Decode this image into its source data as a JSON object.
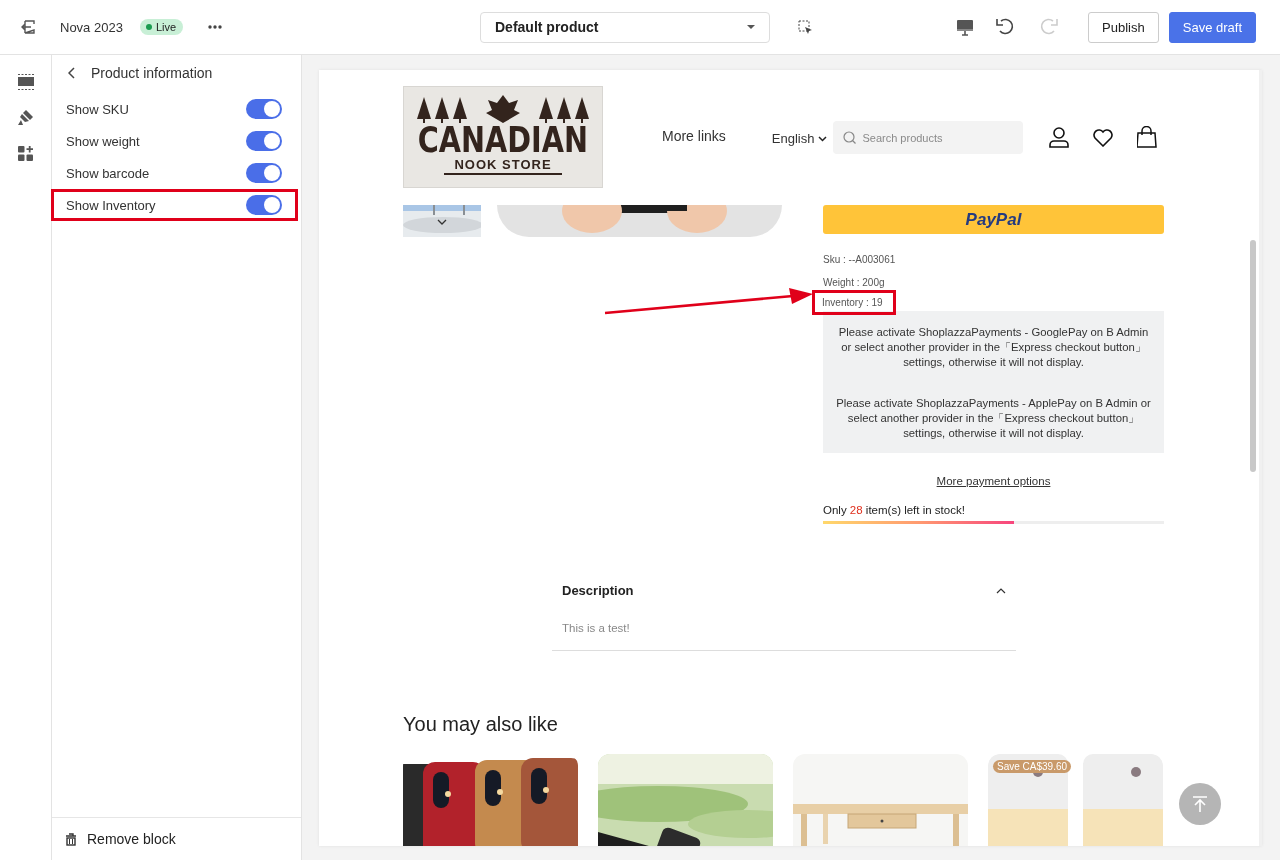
{
  "topbar": {
    "title": "Nova 2023",
    "status": "Live",
    "template": "Default product",
    "redo_disabled": true,
    "buttons": [
      {
        "label": "Publish",
        "kind": "secondary"
      },
      {
        "label": "Save draft",
        "kind": "primary"
      }
    ]
  },
  "panel": {
    "title": "Product information",
    "toggles": [
      {
        "label": "Show SKU",
        "on": true,
        "highlighted": false
      },
      {
        "label": "Show weight",
        "on": true,
        "highlighted": false
      },
      {
        "label": "Show barcode",
        "on": true,
        "highlighted": false
      },
      {
        "label": "Show Inventory",
        "on": true,
        "highlighted": true
      }
    ],
    "footer": "Remove block"
  },
  "preview": {
    "logo": {
      "line1": "CANADIAN",
      "line2": "NOOK STORE"
    },
    "nav": "More links",
    "language": "English",
    "search_placeholder": "Search products",
    "paypal": "PayPal",
    "details": [
      {
        "text": "Sku : --A003061",
        "highlighted": false
      },
      {
        "text": "Weight : 200g",
        "highlighted": false
      },
      {
        "text": "Inventory : 19",
        "highlighted": true
      }
    ],
    "notices": [
      "Please activate ShoplazzaPayments - GooglePay on B Admin or select another provider in the「Express checkout button」 settings, otherwise it will not display.",
      "Please activate ShoplazzaPayments - ApplePay on B Admin or select another provider in the「Express checkout button」settings, otherwise it will not display."
    ],
    "more_payment": "More payment options",
    "stock": {
      "prefix": "Only",
      "count": "28",
      "suffix": "item(s) left in stock!",
      "level": 0.56
    },
    "description": {
      "title": "Description",
      "expanded": true,
      "body": "This is a test!"
    },
    "related": {
      "title": "You may also like",
      "items": [
        {
          "kind": "picture"
        },
        {
          "kind": "picture"
        },
        {
          "kind": "picture"
        },
        {
          "kind": "picture",
          "badge": "Save CA$39.60"
        }
      ]
    }
  }
}
